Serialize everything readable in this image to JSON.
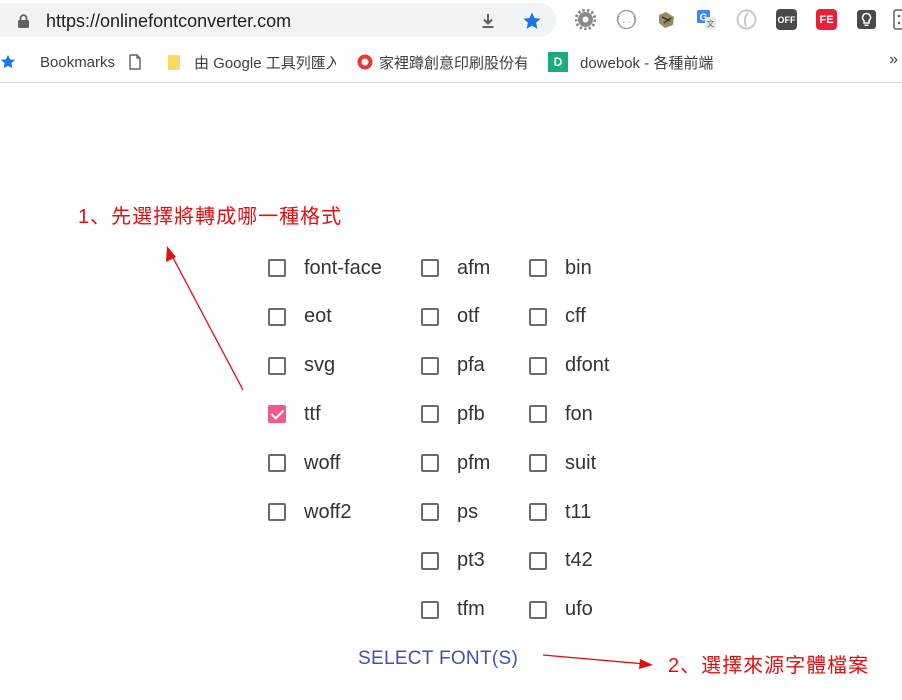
{
  "browser": {
    "url": "https://onlinefontconverter.com",
    "bookmarks": [
      {
        "label": "Bookmarks"
      },
      {
        "label": ""
      },
      {
        "label": "由 Google 工具列匯入"
      },
      {
        "label": "家裡蹲創意印刷股份有"
      },
      {
        "label": "dowebok - 各種前端"
      }
    ],
    "bookmark_badge_letter": "D",
    "ext_off_label": "OFF",
    "ext_fe_label": "FE",
    "more_label": "»"
  },
  "annotations": {
    "step1": "1、先選擇將轉成哪一種格式",
    "step2": "2、選擇來源字體檔案",
    "color": "#e01010"
  },
  "formats": {
    "col1": [
      {
        "label": "font-face",
        "checked": false
      },
      {
        "label": "eot",
        "checked": false
      },
      {
        "label": "svg",
        "checked": false
      },
      {
        "label": "ttf",
        "checked": true
      },
      {
        "label": "woff",
        "checked": false
      },
      {
        "label": "woff2",
        "checked": false
      }
    ],
    "col2": [
      {
        "label": "afm",
        "checked": false
      },
      {
        "label": "otf",
        "checked": false
      },
      {
        "label": "pfa",
        "checked": false
      },
      {
        "label": "pfb",
        "checked": false
      },
      {
        "label": "pfm",
        "checked": false
      },
      {
        "label": "ps",
        "checked": false
      },
      {
        "label": "pt3",
        "checked": false
      },
      {
        "label": "tfm",
        "checked": false
      }
    ],
    "col3": [
      {
        "label": "bin",
        "checked": false
      },
      {
        "label": "cff",
        "checked": false
      },
      {
        "label": "dfont",
        "checked": false
      },
      {
        "label": "fon",
        "checked": false
      },
      {
        "label": "suit",
        "checked": false
      },
      {
        "label": "t11",
        "checked": false
      },
      {
        "label": "t42",
        "checked": false
      },
      {
        "label": "ufo",
        "checked": false
      }
    ]
  },
  "select_button": {
    "label": "SELECT FONT(S)",
    "color": "#3f51b5"
  },
  "colors": {
    "checked": "#ef5a8f",
    "accent_star": "#1a73e8"
  }
}
